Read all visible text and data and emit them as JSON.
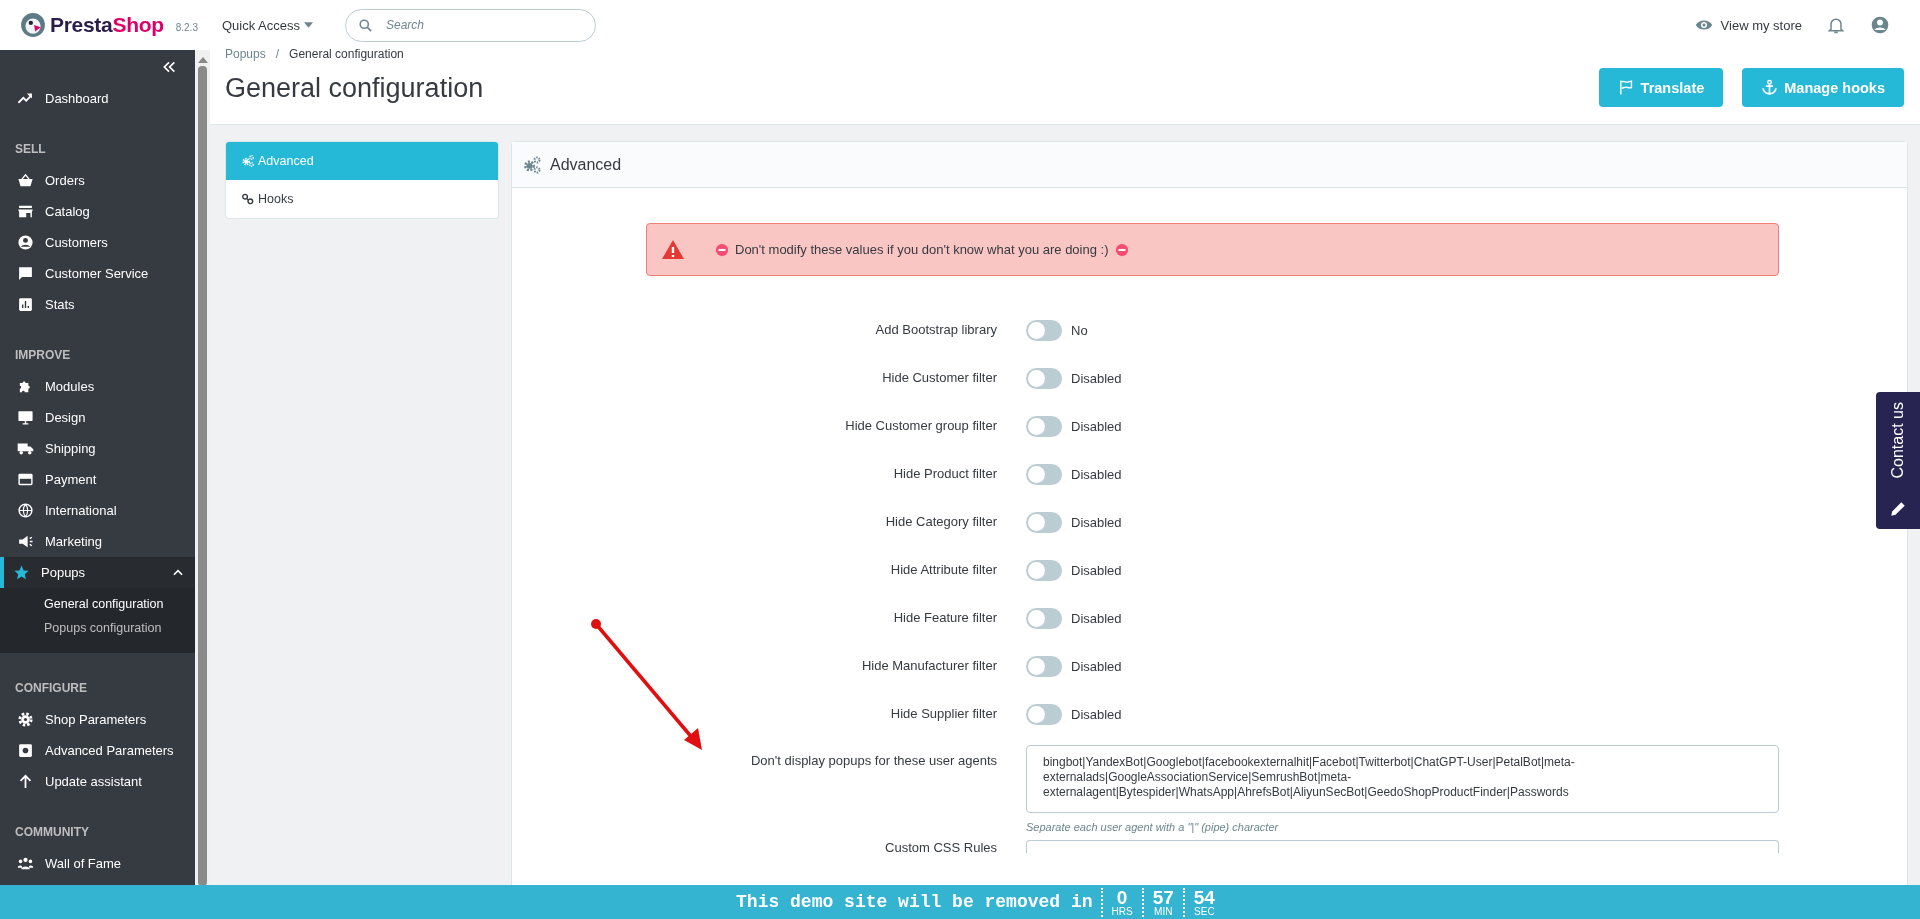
{
  "header": {
    "brand": [
      "Presta",
      "Shop"
    ],
    "version": "8.2.3",
    "quick_access": "Quick Access",
    "search": {
      "placeholder": "Search"
    },
    "view_store": "View my store"
  },
  "sidebar": {
    "sections": [
      {
        "items": [
          {
            "label": "Dashboard",
            "selected": false
          }
        ]
      },
      {
        "heading": "SELL",
        "items": [
          {
            "label": "Orders",
            "selected": false
          },
          {
            "label": "Catalog",
            "selected": false
          },
          {
            "label": "Customers",
            "selected": false
          },
          {
            "label": "Customer Service",
            "selected": false
          },
          {
            "label": "Stats",
            "selected": false
          }
        ]
      },
      {
        "heading": "IMPROVE",
        "items": [
          {
            "label": "Modules",
            "selected": false
          },
          {
            "label": "Design",
            "selected": false
          },
          {
            "label": "Shipping",
            "selected": false
          },
          {
            "label": "Payment",
            "selected": false
          },
          {
            "label": "International",
            "selected": false
          },
          {
            "label": "Marketing",
            "selected": false
          },
          {
            "label": "Popups",
            "selected": true,
            "expanded": true,
            "children": [
              {
                "label": "General configuration",
                "selected": true
              },
              {
                "label": "Popups configuration",
                "selected": false
              }
            ]
          }
        ]
      },
      {
        "heading": "CONFIGURE",
        "items": [
          {
            "label": "Shop Parameters",
            "selected": false
          },
          {
            "label": "Advanced Parameters",
            "selected": false
          },
          {
            "label": "Update assistant",
            "selected": false
          }
        ]
      },
      {
        "heading": "COMMUNITY",
        "items": [
          {
            "label": "Wall of Fame",
            "selected": false
          }
        ]
      }
    ]
  },
  "breadcrumb": {
    "items": [
      "Popups",
      "General configuration"
    ],
    "separator": "/"
  },
  "title": "General configuration",
  "buttons": [
    {
      "label": "Translate"
    },
    {
      "label": "Manage hooks"
    }
  ],
  "tabs": [
    {
      "label": "Advanced",
      "selected": true
    },
    {
      "label": "Hooks",
      "selected": false
    }
  ],
  "panel": {
    "title": "Advanced",
    "alert": "Don't modify these values if you don't know what you are doing :)",
    "switches": [
      {
        "label": "Add Bootstrap library",
        "state_text": "No",
        "on": false
      },
      {
        "label": "Hide Customer filter",
        "state_text": "Disabled",
        "on": false
      },
      {
        "label": "Hide Customer group filter",
        "state_text": "Disabled",
        "on": false
      },
      {
        "label": "Hide Product filter",
        "state_text": "Disabled",
        "on": false
      },
      {
        "label": "Hide Category filter",
        "state_text": "Disabled",
        "on": false
      },
      {
        "label": "Hide Attribute filter",
        "state_text": "Disabled",
        "on": false
      },
      {
        "label": "Hide Feature filter",
        "state_text": "Disabled",
        "on": false
      },
      {
        "label": "Hide Manufacturer filter",
        "state_text": "Disabled",
        "on": false
      },
      {
        "label": "Hide Supplier filter",
        "state_text": "Disabled",
        "on": false
      }
    ],
    "user_agents": {
      "label": "Don't display popups for these user agents",
      "value": "bingbot|YandexBot|Googlebot|facebookexternalhit|Facebot|Twitterbot|ChatGPT-User|PetalBot|meta-externalads|GoogleAssociationService|SemrushBot|meta-externalagent|Bytespider|WhatsApp|AhrefsBot|AliyunSecBot|GeedoShopProductFinder|Passwords",
      "help": "Separate each user agent with a \"|\" (pipe) character"
    },
    "css_rules": {
      "label": "Custom CSS Rules"
    }
  },
  "countdown": {
    "text": "This demo site will be removed in",
    "units": [
      {
        "value": "0",
        "unit": "HRS"
      },
      {
        "value": "57",
        "unit": "MIN"
      },
      {
        "value": "54",
        "unit": "SEC"
      }
    ]
  },
  "contact_tab": "Contact us"
}
